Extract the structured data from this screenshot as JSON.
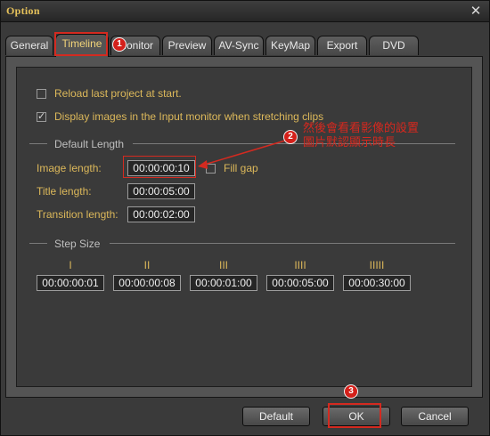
{
  "window": {
    "title": "Option",
    "close_glyph": "✕"
  },
  "tabs": [
    {
      "label": "General"
    },
    {
      "label": "Timeline"
    },
    {
      "label": "Monitor"
    },
    {
      "label": "Preview"
    },
    {
      "label": "AV-Sync"
    },
    {
      "label": "KeyMap"
    },
    {
      "label": "Export"
    },
    {
      "label": "DVD"
    }
  ],
  "timeline": {
    "reload_last_project": {
      "label": "Reload last project at start.",
      "checked": false
    },
    "display_images": {
      "label": "Display images in the Input monitor when stretching clips",
      "checked": true
    },
    "default_length": {
      "header": "Default Length",
      "image_length": {
        "label": "Image length:",
        "value": "00:00:00:10"
      },
      "fill_gap": {
        "label": "Fill gap",
        "checked": false
      },
      "title_length": {
        "label": "Title length:",
        "value": "00:00:05:00"
      },
      "transition_length": {
        "label": "Transition length:",
        "value": "00:00:02:00"
      }
    },
    "step_size": {
      "header": "Step Size",
      "steps": [
        {
          "mark": "I",
          "value": "00:00:00:01"
        },
        {
          "mark": "II",
          "value": "00:00:00:08"
        },
        {
          "mark": "III",
          "value": "00:00:01:00"
        },
        {
          "mark": "IIII",
          "value": "00:00:05:00"
        },
        {
          "mark": "IIIII",
          "value": "00:00:30:00"
        }
      ]
    }
  },
  "buttons": {
    "default": "Default",
    "ok": "OK",
    "cancel": "Cancel"
  },
  "annotations": {
    "badge1": "1",
    "badge2": "2",
    "badge3": "3",
    "note_line1": "然後會看看影像的設置",
    "note_line2": "圖片默認顯示時長"
  },
  "colors": {
    "accent_text": "#dcb85a",
    "annotation_red": "#d42a20",
    "panel_bg": "#3a3a3a"
  }
}
